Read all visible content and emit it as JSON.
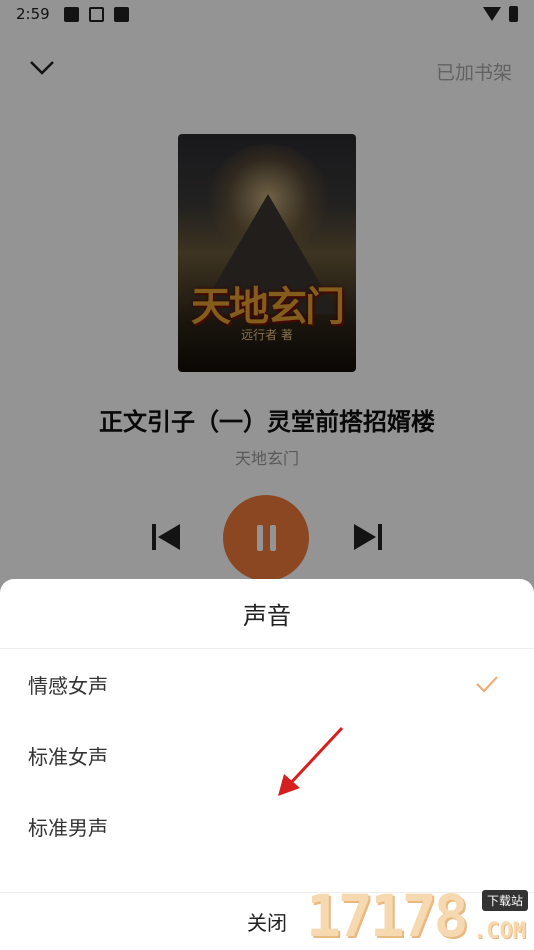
{
  "status_bar": {
    "time": "2:59"
  },
  "header": {
    "shelf_label": "已加书架"
  },
  "book": {
    "cover_title": "天地玄门",
    "cover_author": "远行者 著",
    "chapter_title": "正文引子（一）灵堂前搭招婿楼",
    "book_name": "天地玄门"
  },
  "voice_sheet": {
    "title": "声音",
    "options": [
      {
        "label": "情感女声",
        "selected": true
      },
      {
        "label": "标准女声",
        "selected": false
      },
      {
        "label": "标准男声",
        "selected": false
      }
    ],
    "close_label": "关闭"
  },
  "watermark": {
    "number": "17178",
    "tag": "下载站",
    "domain": ".COM"
  },
  "colors": {
    "accent": "#f07a3a",
    "check": "#f5a46a",
    "annotation_arrow": "#d62020"
  }
}
